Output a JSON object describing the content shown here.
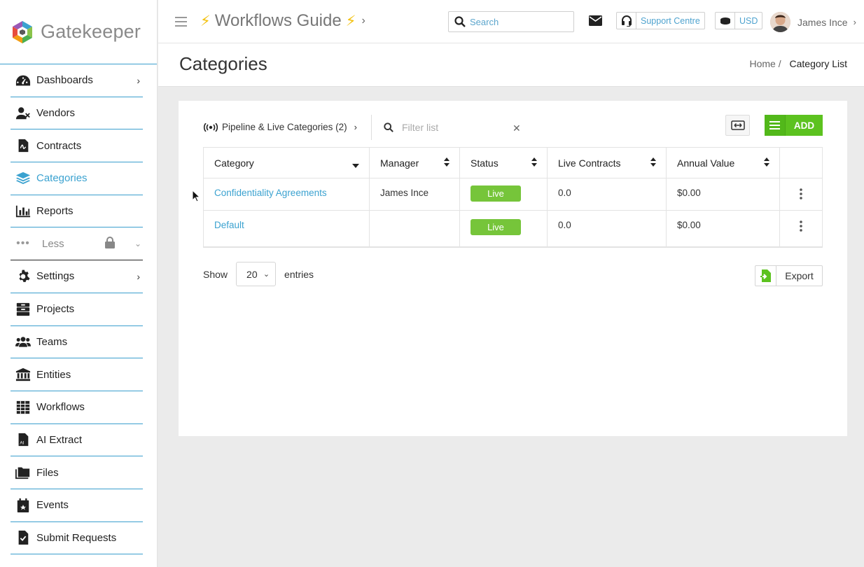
{
  "app": {
    "name": "Gatekeeper"
  },
  "sidebar": {
    "items": [
      {
        "label": "Dashboards",
        "icon": "dashboard-icon"
      },
      {
        "label": "Vendors",
        "icon": "vendors-icon"
      },
      {
        "label": "Contracts",
        "icon": "contracts-icon"
      },
      {
        "label": "Categories",
        "icon": "categories-icon"
      },
      {
        "label": "Reports",
        "icon": "reports-icon"
      },
      {
        "label": "Less",
        "icon": "more-dots-icon"
      },
      {
        "label": "Settings",
        "icon": "gear-icon"
      },
      {
        "label": "Projects",
        "icon": "projects-icon"
      },
      {
        "label": "Teams",
        "icon": "teams-icon"
      },
      {
        "label": "Entities",
        "icon": "bank-icon"
      },
      {
        "label": "Workflows",
        "icon": "grid-icon"
      },
      {
        "label": "AI Extract",
        "icon": "ai-file-icon"
      },
      {
        "label": "Files",
        "icon": "folder-icon"
      },
      {
        "label": "Events",
        "icon": "calendar-icon"
      },
      {
        "label": "Submit Requests",
        "icon": "check-file-icon"
      }
    ],
    "active": "Categories"
  },
  "topbar": {
    "workflow_title": "Workflows Guide",
    "search_placeholder": "Search",
    "support_label": "Support Centre",
    "currency": "USD",
    "user_name": "James Ince"
  },
  "page": {
    "title": "Categories",
    "breadcrumb_home": "Home",
    "breadcrumb_sep": "/",
    "breadcrumb_current": "Category List"
  },
  "toolbar": {
    "pipeline_label": "Pipeline & Live Categories (2)",
    "filter_placeholder": "Filter list",
    "add_label": "ADD"
  },
  "table": {
    "columns": [
      "Category",
      "Manager",
      "Status",
      "Live Contracts",
      "Annual Value"
    ],
    "rows": [
      {
        "category": "Confidentiality Agreements",
        "manager": "James Ince",
        "status": "Live",
        "live_contracts": "0.0",
        "annual_value": "$0.00"
      },
      {
        "category": "Default",
        "manager": "",
        "status": "Live",
        "live_contracts": "0.0",
        "annual_value": "$0.00"
      }
    ]
  },
  "footer": {
    "show_label": "Show",
    "entries_value": "20",
    "entries_label": "entries",
    "export_label": "Export"
  },
  "colors": {
    "accent_blue": "#3ba2d0",
    "add_green": "#5cc21f",
    "live_green": "#76c53a",
    "bolt_yellow": "#f3c10f"
  }
}
